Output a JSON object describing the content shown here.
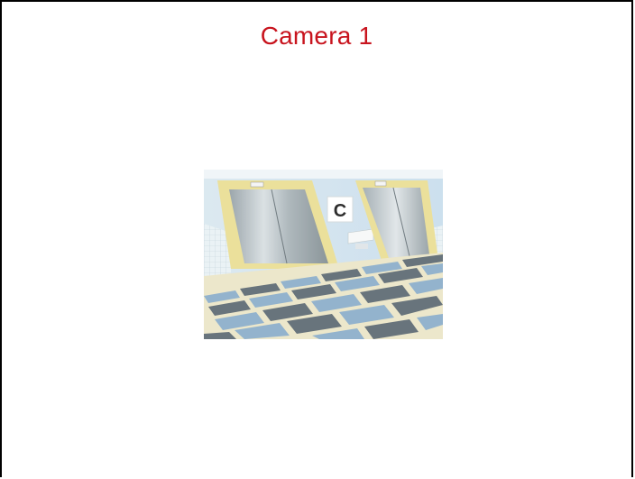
{
  "view": {
    "title": "Camera 1",
    "title_color": "#c8141e"
  },
  "feed": {
    "sign_letter": "C",
    "scene": "elevator-lobby-image"
  }
}
